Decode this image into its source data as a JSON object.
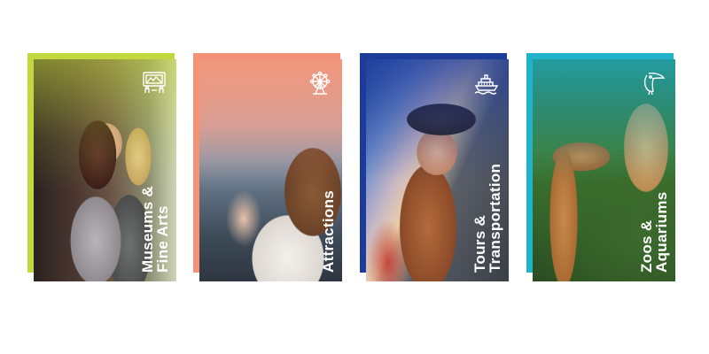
{
  "cards": [
    {
      "id": "museums",
      "line1": "Museums &",
      "line2": "Fine Arts",
      "icon": "museum-painting-icon",
      "color": "#c3d83e"
    },
    {
      "id": "attractions",
      "line1": "Attractions",
      "line2": "",
      "icon": "ferris-wheel-icon",
      "color": "#f39277"
    },
    {
      "id": "tours",
      "line1": "Tours &",
      "line2": "Transportation",
      "icon": "cruise-ship-icon",
      "color": "#1d3c9a"
    },
    {
      "id": "zoos",
      "line1": "Zoos &",
      "line2": "Aquariums",
      "icon": "toucan-icon",
      "color": "#21b3c9"
    }
  ]
}
